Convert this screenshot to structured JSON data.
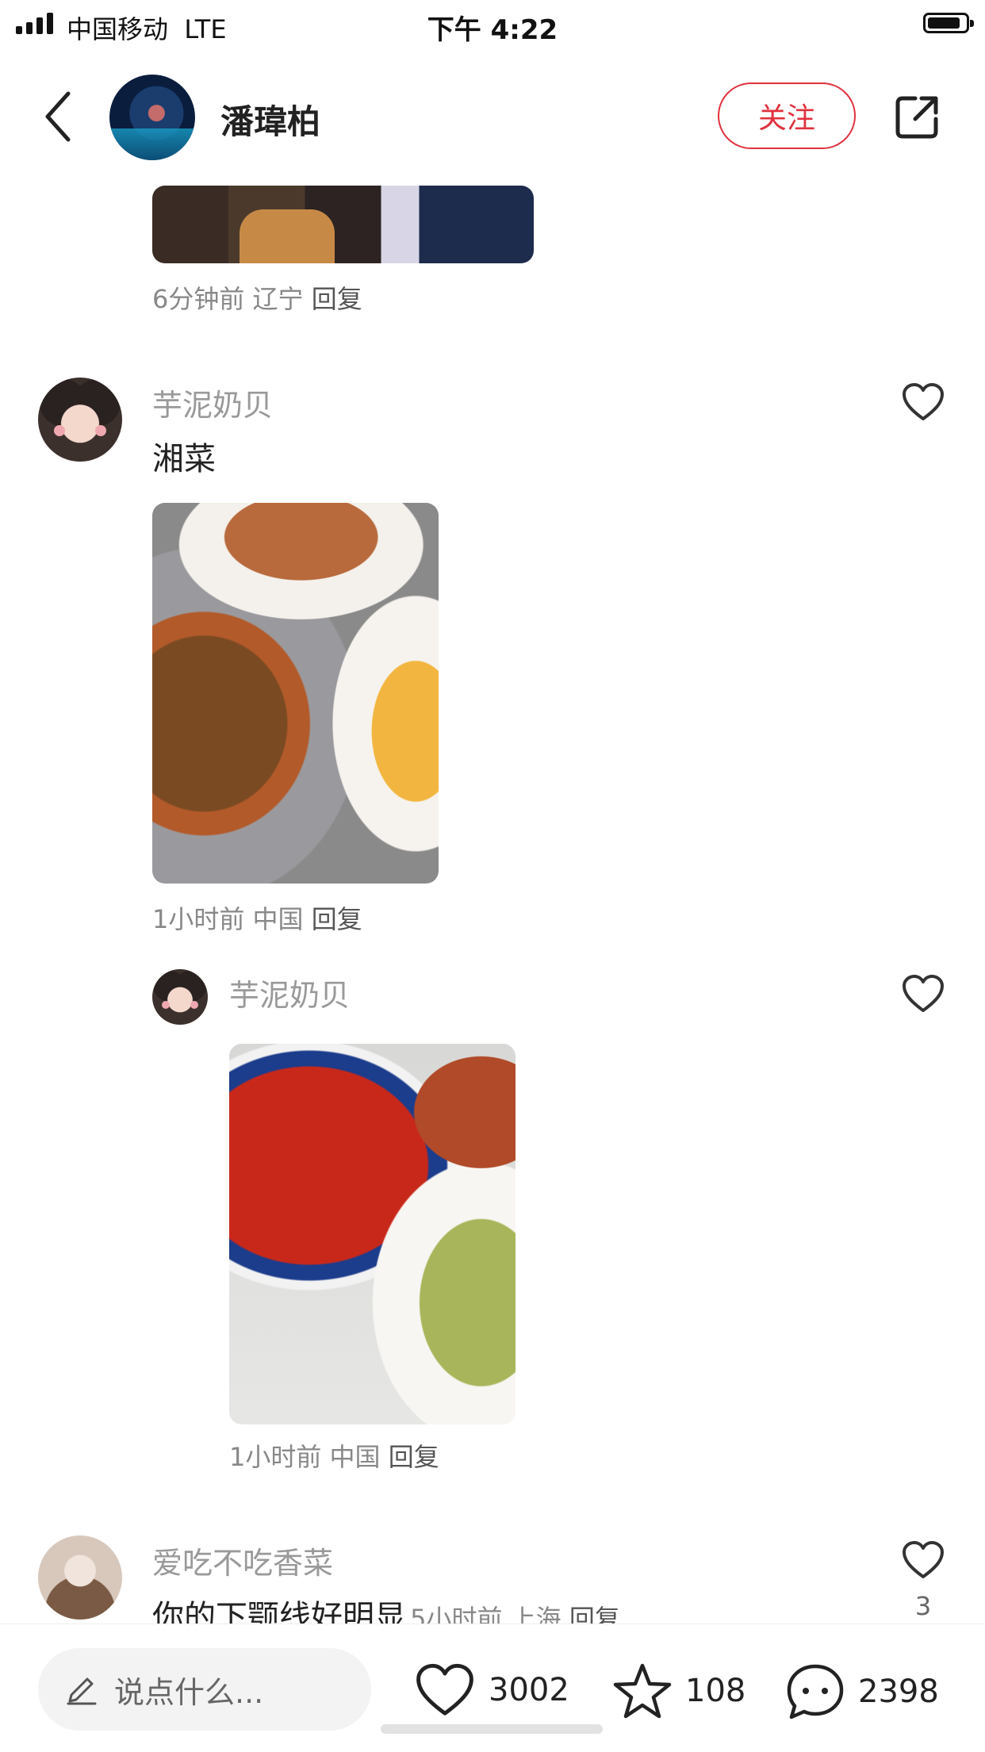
{
  "status_bar": {
    "carrier": "中国移动",
    "network": "LTE",
    "time": "下午 4:22"
  },
  "header": {
    "username": "潘瑋柏",
    "follow_label": "关注"
  },
  "top_comment": {
    "time": "6分钟前",
    "location": "辽宁",
    "reply": "回复"
  },
  "comments": [
    {
      "name": "芋泥奶贝",
      "text": "湘菜",
      "time": "1小时前",
      "location": "中国",
      "reply": "回复"
    },
    {
      "name": "芋泥奶贝",
      "time": "1小时前",
      "location": "中国",
      "reply": "回复"
    },
    {
      "name": "爱吃不吃香菜",
      "text": "你的下颚线好明显",
      "time": "5小时前",
      "location": "上海",
      "reply": "回复",
      "likes": "3"
    }
  ],
  "bottom_bar": {
    "input_placeholder": "说点什么...",
    "likes": "3002",
    "favorites": "108",
    "comments": "2398"
  },
  "colors": {
    "accent": "#e0323e",
    "meta_text": "#888888",
    "name_text": "#999999"
  },
  "icons": [
    "back-icon",
    "share-icon",
    "heart-icon",
    "star-icon",
    "comment-icon",
    "pen-icon"
  ]
}
